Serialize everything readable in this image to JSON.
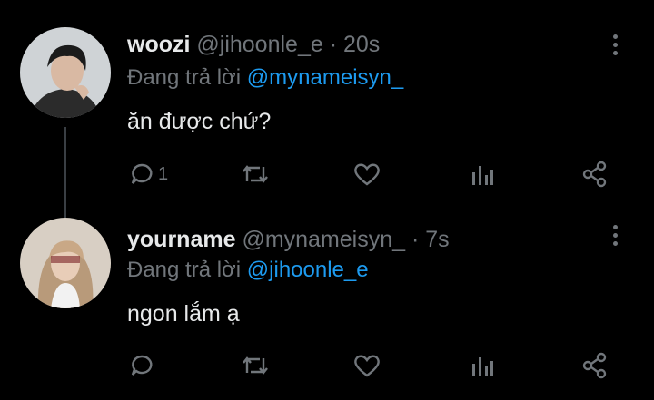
{
  "tweets": [
    {
      "name": "woozi",
      "handle": "@jihoonle_e",
      "time": "· 20s",
      "reply_prefix": "Đang trả lời",
      "reply_to": "@mynameisyn_",
      "text": "ăn được chứ?",
      "reply_count": "1"
    },
    {
      "name": "yourname",
      "handle": "@mynameisyn_",
      "time": "· 7s",
      "reply_prefix": "Đang trả lời",
      "reply_to": "@jihoonle_e",
      "text": "ngon lắm ạ",
      "reply_count": ""
    }
  ],
  "icons": [
    "reply-icon",
    "retweet-icon",
    "like-icon",
    "analytics-icon",
    "share-icon",
    "more-icon"
  ],
  "colors": {
    "background": "#000000",
    "text": "#e7e9ea",
    "muted": "#71767b",
    "link": "#1d9bf0"
  }
}
